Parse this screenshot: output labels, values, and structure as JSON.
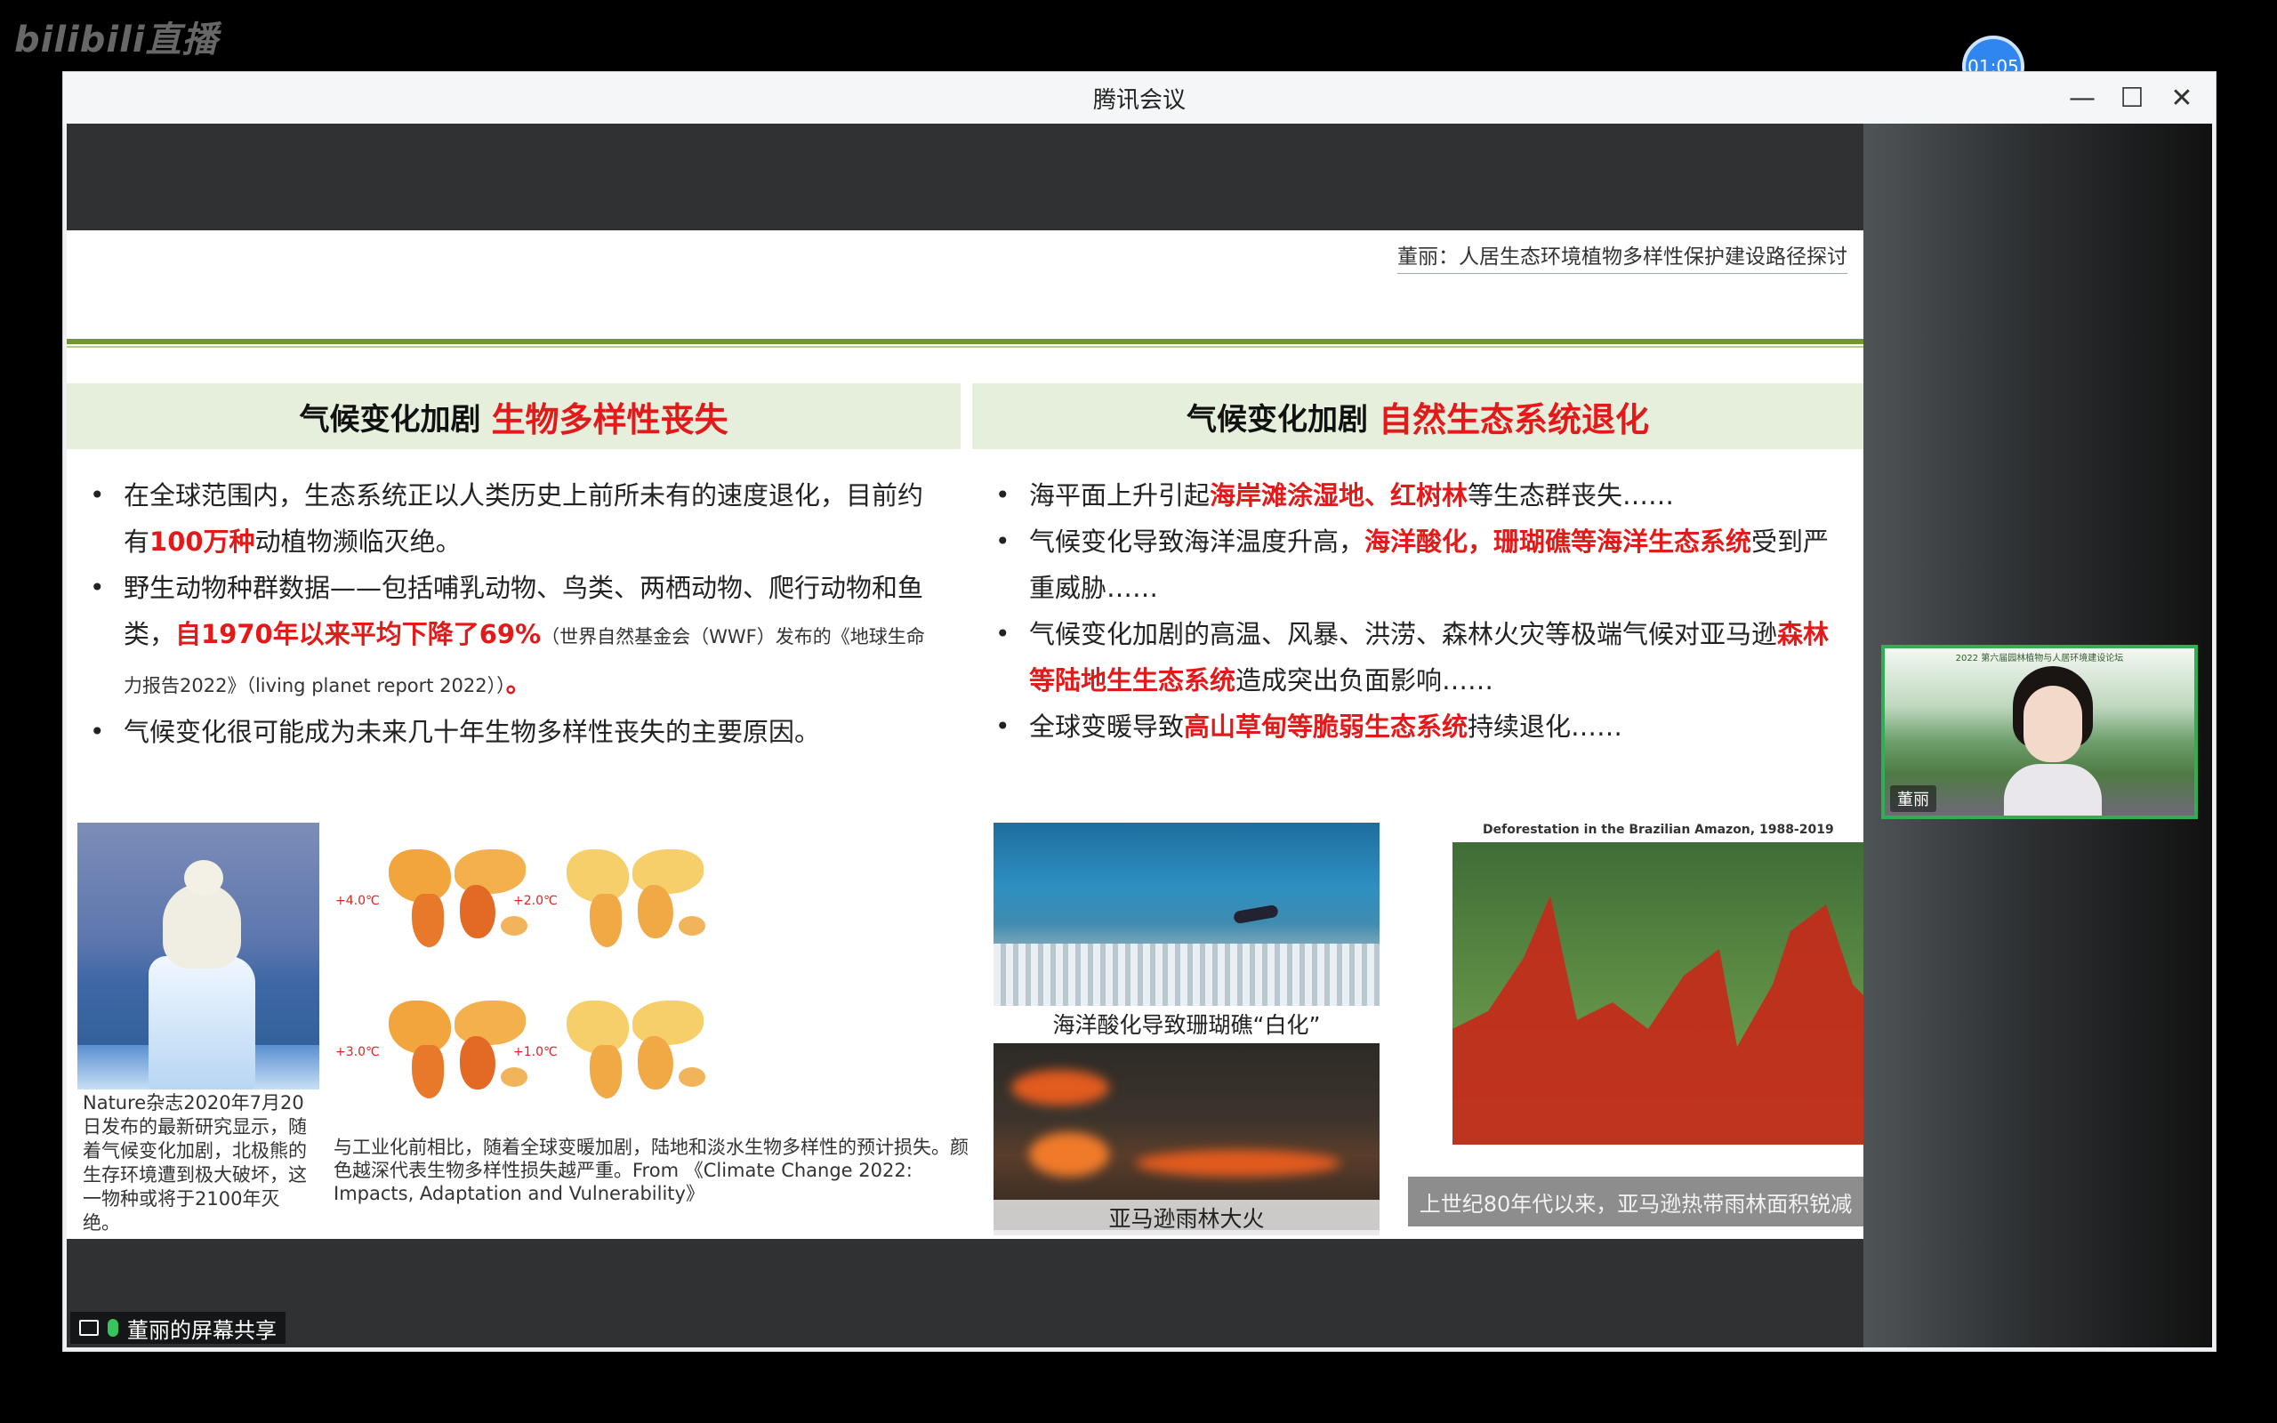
{
  "overlay": {
    "watermark": "bilibili直播",
    "timer": "01:05"
  },
  "window": {
    "title": "腾讯会议",
    "controls": {
      "minimize": "—",
      "maximize": "☐",
      "close": "✕"
    }
  },
  "slide": {
    "source": "董丽：人居生态环境植物多样性保护建设路径探讨",
    "left": {
      "header_prefix": "气候变化加剧",
      "header_highlight": "生物多样性丧失",
      "bullets": [
        {
          "a": "在全球范围内，生态系统正以人类历史上前所未有的速度退化，目前约有",
          "hl": "100万种",
          "b": "动植物濒临灭绝。"
        },
        {
          "a": "野生动物种群数据——包括哺乳动物、鸟类、两栖动物、爬行动物和鱼类，",
          "hl": "自1970年以来平均下降了69%",
          "small": "（世界自然基金会（WWF）发布的《地球生命力报告2022》（living planet report 2022））",
          "b": "。"
        },
        {
          "a": "气候变化很可能成为未来几十年生物多样性丧失的主要原因。"
        }
      ],
      "polar_caption": "Nature杂志2020年7月20日发布的最新研究显示，随着气候变化加剧，北极熊的生存环境遭到极大破坏，这一物种或将于2100年灭绝。",
      "maps_caption": "与工业化前相比，随着全球变暖加剧，陆地和淡水生物多样性的预计损失。颜色越深代表生物多样性损失越严重。From 《Climate Change 2022: Impacts, Adaptation and Vulnerability》",
      "map_labels": [
        "+4.0℃",
        "+2.0℃",
        "+3.0℃",
        "+1.0℃"
      ]
    },
    "right": {
      "header_prefix": "气候变化加剧",
      "header_highlight": "自然生态系统退化",
      "bullets": [
        {
          "a": "海平面上升引起",
          "hl": "海岸滩涂湿地、红树林",
          "b": "等生态群丧失……"
        },
        {
          "a": "气候变化导致海洋温度升高，",
          "hl": "海洋酸化，珊瑚礁等海洋生态系统",
          "b": "受到严重威胁……"
        },
        {
          "a": "气候变化加剧的高温、风暴、洪涝、森林火灾等极端气候对亚马逊",
          "hl": "森林等陆地生生态系统",
          "b": "造成突出负面影响……"
        },
        {
          "a": "全球变暖导致",
          "hl": "高山草甸等脆弱生态系统",
          "b": "持续退化……"
        }
      ],
      "coral_caption": "海洋酸化导致珊瑚礁“白化”",
      "fire_caption": "亚马逊雨林大火",
      "defo_title": "Deforestation in the Brazilian Amazon, 1988-2019",
      "defo_caption": "上世纪80年代以来，亚马逊热带雨林面积锐减"
    }
  },
  "participant": {
    "banner": "2022 第六届园林植物与人居环境建设论坛",
    "name": "董丽"
  },
  "share": {
    "label": "董丽的屏幕共享"
  }
}
